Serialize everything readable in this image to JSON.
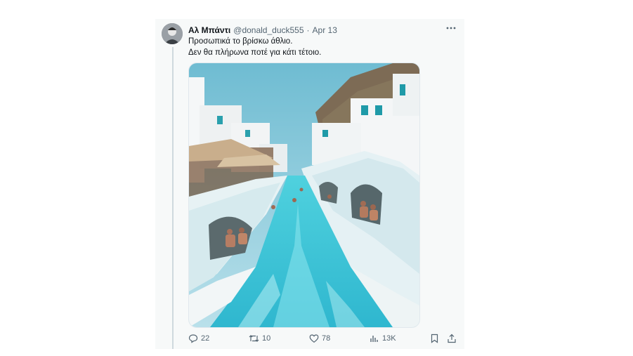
{
  "tweet": {
    "author_name": "Αλ Μπάντι",
    "handle": "@donald_duck555",
    "separator": "·",
    "date": "Apr 13",
    "more_icon": "more-horizontal-icon",
    "text_lines": [
      "Προσωπικά το βρίσκω άθλιο.",
      "Δεν θα πλήρωνα ποτέ για κάτι τέτοιο."
    ]
  },
  "actions": {
    "replies": "22",
    "reposts": "10",
    "likes": "78",
    "views": "13K",
    "icons": [
      "reply-icon",
      "repost-icon",
      "like-icon",
      "views-icon",
      "bookmark-icon",
      "share-icon"
    ]
  },
  "colors": {
    "card_bg": "#f7f9f9",
    "muted_text": "#536471",
    "thread_line": "#cfd9de",
    "water": "#3ec6d6",
    "sky": "#7fc7d9"
  }
}
